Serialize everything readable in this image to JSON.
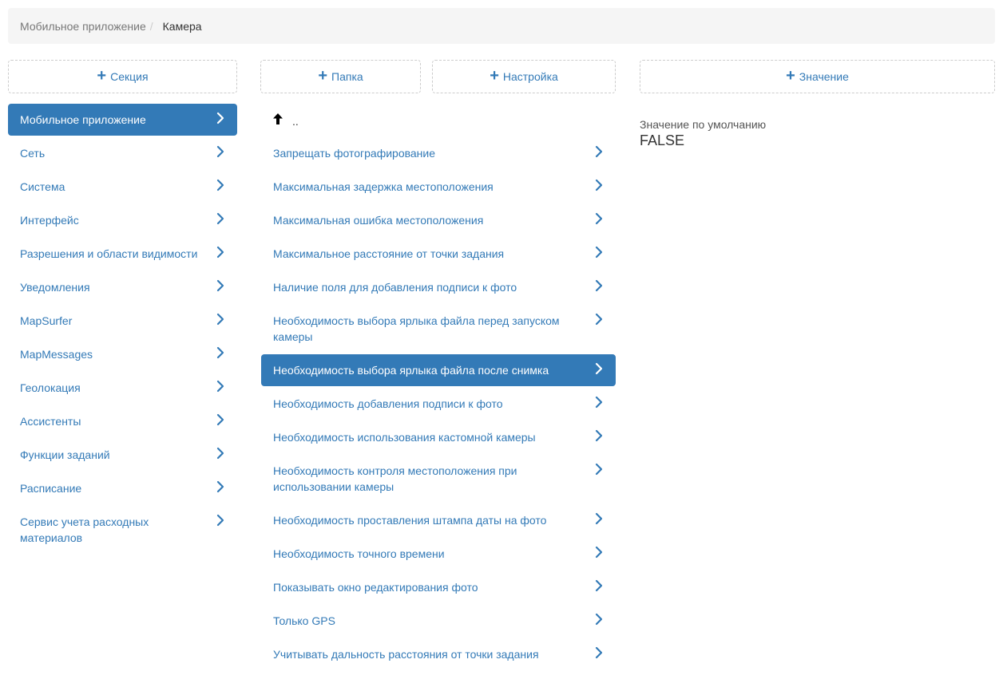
{
  "breadcrumb": {
    "parent": "Мобильное приложение",
    "separator": "/",
    "current": "Камера"
  },
  "buttons": {
    "section": "Секция",
    "folder": "Папка",
    "setting": "Настройка",
    "value": "Значение"
  },
  "sections": [
    {
      "label": "Мобильное приложение",
      "active": true
    },
    {
      "label": "Сеть"
    },
    {
      "label": "Система"
    },
    {
      "label": "Интерфейс"
    },
    {
      "label": "Разрешения и области видимости"
    },
    {
      "label": "Уведомления"
    },
    {
      "label": "MapSurfer"
    },
    {
      "label": "MapMessages"
    },
    {
      "label": "Геолокация"
    },
    {
      "label": "Ассистенты"
    },
    {
      "label": "Функции заданий"
    },
    {
      "label": "Расписание"
    },
    {
      "label": "Сервис учета расходных материалов"
    }
  ],
  "settings_up": "..",
  "settings": [
    {
      "label": "Запрещать фотографирование"
    },
    {
      "label": "Максимальная задержка местоположения"
    },
    {
      "label": "Максимальная ошибка местоположения"
    },
    {
      "label": "Максимальное расстояние от точки задания"
    },
    {
      "label": "Наличие поля для добавления подписи к фото"
    },
    {
      "label": "Необходимость выбора ярлыка файла перед запуском камеры"
    },
    {
      "label": "Необходимость выбора ярлыка файла после снимка",
      "active": true
    },
    {
      "label": "Необходимость добавления подписи к фото"
    },
    {
      "label": "Необходимость использования кастомной камеры"
    },
    {
      "label": "Необходимость контроля местоположения при использовании камеры"
    },
    {
      "label": "Необходимость проставления штампа даты на фото"
    },
    {
      "label": "Необходимость точного времени"
    },
    {
      "label": "Показывать окно редактирования фото"
    },
    {
      "label": "Только GPS"
    },
    {
      "label": "Учитывать дальность расстояния от точки задания"
    }
  ],
  "value_panel": {
    "label": "Значение по умолчанию",
    "value": "FALSE"
  },
  "icons": {
    "plus": "plus-icon",
    "chevron": "chevron-right-icon",
    "up": "arrow-up-icon"
  },
  "colors": {
    "accent": "#337ab7",
    "breadcrumb_bg": "#f5f5f5"
  }
}
